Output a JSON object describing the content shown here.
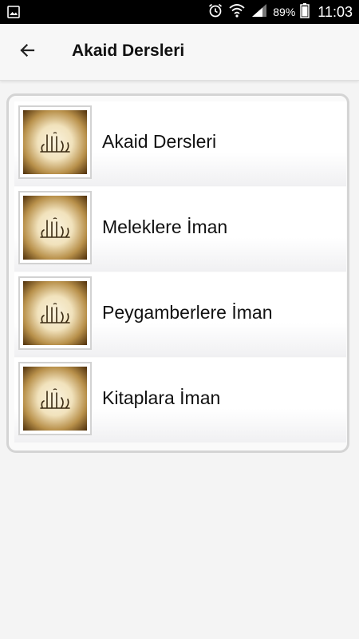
{
  "status_bar": {
    "battery_percent": "89%",
    "time": "11:03",
    "icons": [
      "gallery-icon",
      "alarm-icon",
      "wifi-icon",
      "signal-icon",
      "battery-icon"
    ]
  },
  "toolbar": {
    "title": "Akaid Dersleri",
    "back_icon": "arrow-back-icon"
  },
  "list": {
    "items": [
      {
        "label": "Akaid Dersleri",
        "icon": "allah-calligraphy-icon"
      },
      {
        "label": "Meleklere İman",
        "icon": "allah-calligraphy-icon"
      },
      {
        "label": "Peygamberlere İman",
        "icon": "allah-calligraphy-icon"
      },
      {
        "label": "Kitaplara İman",
        "icon": "allah-calligraphy-icon"
      }
    ]
  },
  "colors": {
    "status_bar_bg": "#000000",
    "toolbar_bg": "#f7f7f7",
    "page_bg": "#f4f4f4",
    "card_border": "#d4d4d4",
    "text": "#111111"
  }
}
